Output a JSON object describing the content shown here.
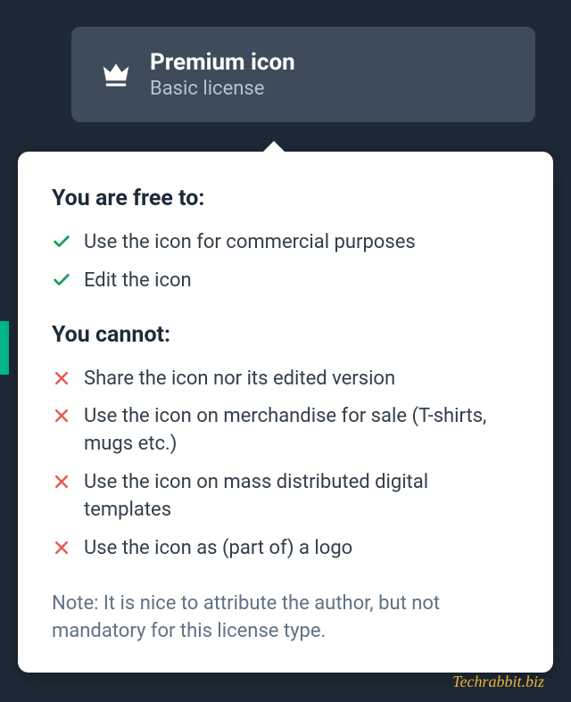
{
  "header": {
    "title": "Premium icon",
    "subtitle": "Basic license"
  },
  "sections": {
    "allowed_heading": "You are free to:",
    "allowed": [
      "Use the icon for commercial purposes",
      "Edit the icon"
    ],
    "denied_heading": "You cannot:",
    "denied": [
      "Share the icon nor its edited version",
      "Use the icon on merchandise for sale (T-shirts, mugs etc.)",
      "Use the icon on mass distributed digital templates",
      "Use the icon as (part of) a logo"
    ]
  },
  "note": "Note: It is nice to attribute the author, but not mandatory for this license type.",
  "watermark": "Techrabbit.biz"
}
